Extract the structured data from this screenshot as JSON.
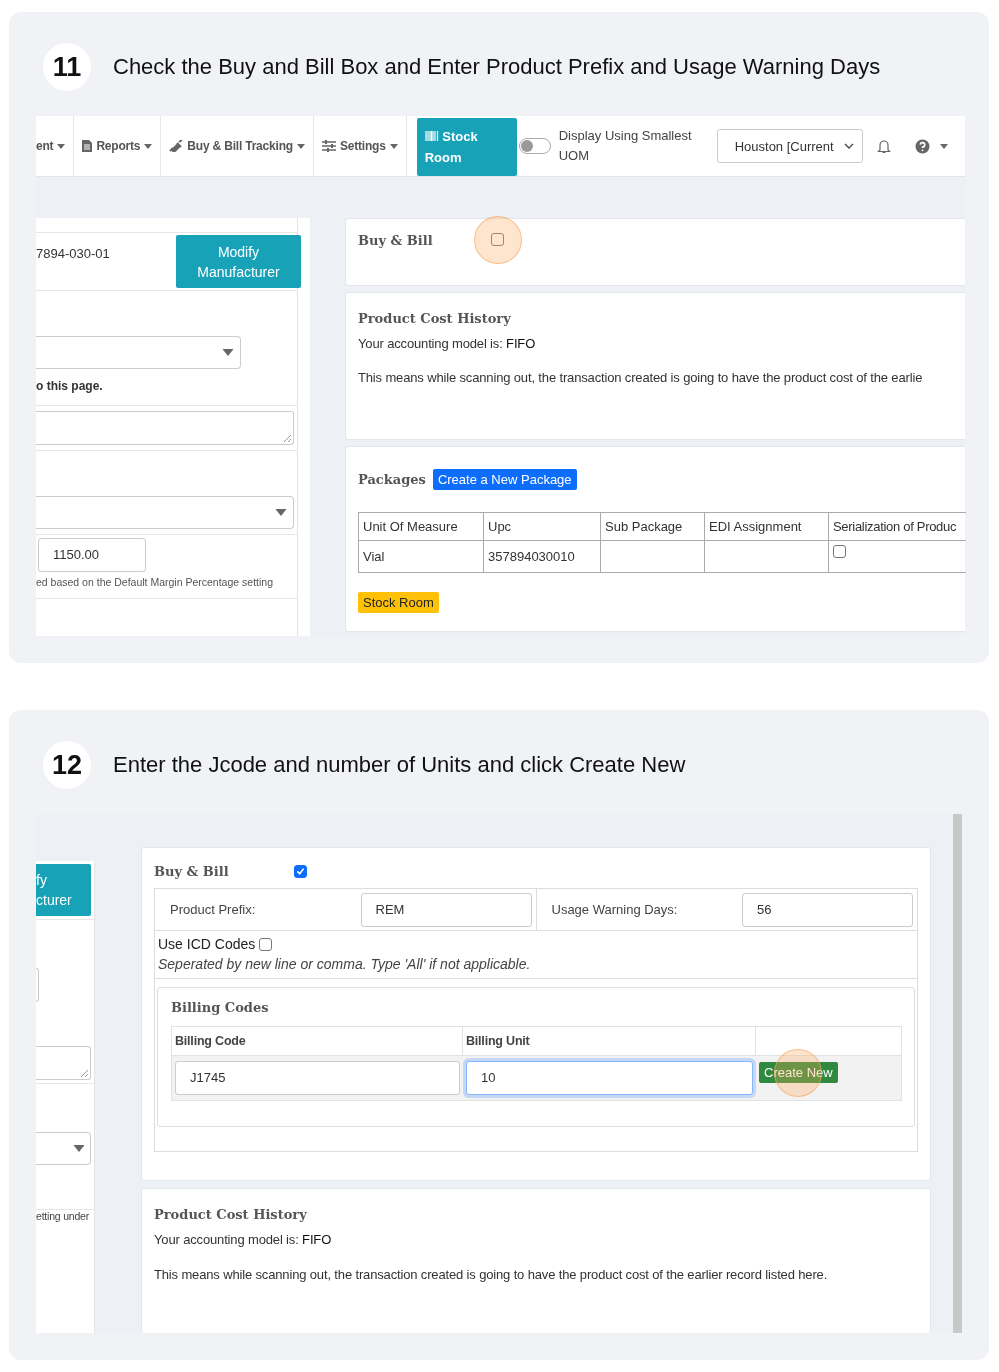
{
  "steps": [
    {
      "number": "11",
      "title": "Check the Buy and Bill Box and Enter Product Prefix and Usage Warning Days",
      "kind": "packages",
      "navbar": {
        "items": [
          {
            "label": "ent"
          },
          {
            "label": "Reports"
          },
          {
            "label": "Buy & Bill Tracking"
          },
          {
            "label": "Settings"
          }
        ],
        "stock_room": "Stock Room",
        "uom_toggle": {
          "label": "Display Using Smallest UOM",
          "on": false
        },
        "location": "Houston [Current"
      },
      "left_panel": {
        "code": "7894-030-01",
        "modify_button": "Modify Manufacturer",
        "note": "o this page.",
        "price": "1150.00",
        "price_hint": "ed based on the Default Margin Percentage setting"
      },
      "buy_bill": {
        "label": "Buy & Bill",
        "checked": false,
        "highlighted": true
      },
      "cost_history": {
        "title": "Product Cost History",
        "model_label": "Your accounting model is:",
        "model": "FIFO",
        "description": "This means while scanning out, the transaction created is going to have the product cost of the earlie"
      },
      "packages": {
        "title": "Packages",
        "create_button": "Create a New Package",
        "columns": [
          "Unit Of Measure",
          "Upc",
          "Sub Package",
          "EDI Assignment",
          "Serialization of Produc"
        ],
        "rows": [
          {
            "unit": "Vial",
            "upc": "357894030010",
            "serialized": false
          }
        ],
        "stock_room_tag": "Stock Room"
      }
    },
    {
      "number": "12",
      "title": "Enter the Jcode and number of Units and click Create New",
      "kind": "billing",
      "left_panel": {
        "button_lines": [
          "fy",
          "cturer"
        ],
        "hint": "etting under"
      },
      "buy_bill": {
        "label": "Buy & Bill",
        "checked": true
      },
      "fields": [
        {
          "label": "Product Prefix:",
          "value": "REM"
        },
        {
          "label": "Usage Warning Days:",
          "value": "56"
        }
      ],
      "icd": {
        "label": "Use ICD Codes",
        "checked": false,
        "hint": "Seperated by new line or comma. Type 'All' if not applicable."
      },
      "billing_codes": {
        "title": "Billing Codes",
        "columns": [
          "Billing Code",
          "Billing Unit"
        ],
        "code": "J1745",
        "unit": "10",
        "unit_focused": true,
        "create_button": "Create New",
        "create_highlighted": true
      },
      "cost_history": {
        "title": "Product Cost History",
        "model_label": "Your accounting model is:",
        "model": "FIFO",
        "description": "This means while scanning out, the transaction created is going to have the product cost of the earlier record listed here."
      }
    }
  ]
}
